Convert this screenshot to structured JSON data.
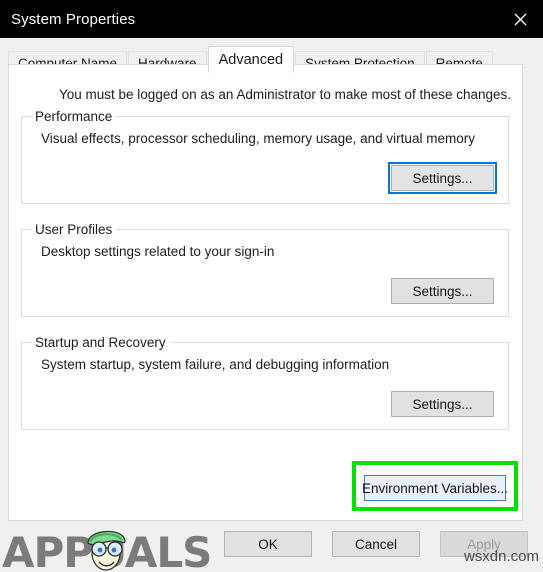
{
  "window": {
    "title": "System Properties",
    "close_icon": "close-icon",
    "titlebar_color": "#000000",
    "accent_color": "#0078d7",
    "highlight_color": "#00e100"
  },
  "tabs": [
    {
      "label": "Computer Name",
      "selected": false
    },
    {
      "label": "Hardware",
      "selected": false
    },
    {
      "label": "Advanced",
      "selected": true
    },
    {
      "label": "System Protection",
      "selected": false
    },
    {
      "label": "Remote",
      "selected": false
    }
  ],
  "page": {
    "intro": "You must be logged on as an Administrator to make most of these changes.",
    "groups": [
      {
        "legend": "Performance",
        "description": "Visual effects, processor scheduling, memory usage, and virtual memory",
        "button_label": "Settings...",
        "button_focused": true
      },
      {
        "legend": "User Profiles",
        "description": "Desktop settings related to your sign-in",
        "button_label": "Settings...",
        "button_focused": false
      },
      {
        "legend": "Startup and Recovery",
        "description": "System startup, system failure, and debugging information",
        "button_label": "Settings...",
        "button_focused": false
      }
    ],
    "environment_variables_button": {
      "label": "Environment Variables...",
      "highlighted": true
    }
  },
  "footer": {
    "ok_label": "OK",
    "cancel_label": "Cancel",
    "apply_label": "Apply",
    "apply_disabled": true
  },
  "watermarks": {
    "brand": "APPUALS",
    "source": "wsxdn.com"
  }
}
